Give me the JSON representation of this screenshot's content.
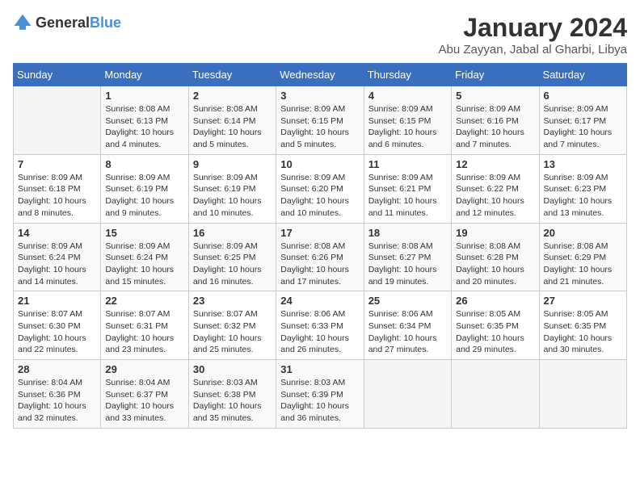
{
  "header": {
    "logo_general": "General",
    "logo_blue": "Blue",
    "month_year": "January 2024",
    "location": "Abu Zayyan, Jabal al Gharbi, Libya"
  },
  "weekdays": [
    "Sunday",
    "Monday",
    "Tuesday",
    "Wednesday",
    "Thursday",
    "Friday",
    "Saturday"
  ],
  "weeks": [
    [
      {
        "day": "",
        "info": ""
      },
      {
        "day": "1",
        "info": "Sunrise: 8:08 AM\nSunset: 6:13 PM\nDaylight: 10 hours\nand 4 minutes."
      },
      {
        "day": "2",
        "info": "Sunrise: 8:08 AM\nSunset: 6:14 PM\nDaylight: 10 hours\nand 5 minutes."
      },
      {
        "day": "3",
        "info": "Sunrise: 8:09 AM\nSunset: 6:15 PM\nDaylight: 10 hours\nand 5 minutes."
      },
      {
        "day": "4",
        "info": "Sunrise: 8:09 AM\nSunset: 6:15 PM\nDaylight: 10 hours\nand 6 minutes."
      },
      {
        "day": "5",
        "info": "Sunrise: 8:09 AM\nSunset: 6:16 PM\nDaylight: 10 hours\nand 7 minutes."
      },
      {
        "day": "6",
        "info": "Sunrise: 8:09 AM\nSunset: 6:17 PM\nDaylight: 10 hours\nand 7 minutes."
      }
    ],
    [
      {
        "day": "7",
        "info": "Sunrise: 8:09 AM\nSunset: 6:18 PM\nDaylight: 10 hours\nand 8 minutes."
      },
      {
        "day": "8",
        "info": "Sunrise: 8:09 AM\nSunset: 6:19 PM\nDaylight: 10 hours\nand 9 minutes."
      },
      {
        "day": "9",
        "info": "Sunrise: 8:09 AM\nSunset: 6:19 PM\nDaylight: 10 hours\nand 10 minutes."
      },
      {
        "day": "10",
        "info": "Sunrise: 8:09 AM\nSunset: 6:20 PM\nDaylight: 10 hours\nand 10 minutes."
      },
      {
        "day": "11",
        "info": "Sunrise: 8:09 AM\nSunset: 6:21 PM\nDaylight: 10 hours\nand 11 minutes."
      },
      {
        "day": "12",
        "info": "Sunrise: 8:09 AM\nSunset: 6:22 PM\nDaylight: 10 hours\nand 12 minutes."
      },
      {
        "day": "13",
        "info": "Sunrise: 8:09 AM\nSunset: 6:23 PM\nDaylight: 10 hours\nand 13 minutes."
      }
    ],
    [
      {
        "day": "14",
        "info": "Sunrise: 8:09 AM\nSunset: 6:24 PM\nDaylight: 10 hours\nand 14 minutes."
      },
      {
        "day": "15",
        "info": "Sunrise: 8:09 AM\nSunset: 6:24 PM\nDaylight: 10 hours\nand 15 minutes."
      },
      {
        "day": "16",
        "info": "Sunrise: 8:09 AM\nSunset: 6:25 PM\nDaylight: 10 hours\nand 16 minutes."
      },
      {
        "day": "17",
        "info": "Sunrise: 8:08 AM\nSunset: 6:26 PM\nDaylight: 10 hours\nand 17 minutes."
      },
      {
        "day": "18",
        "info": "Sunrise: 8:08 AM\nSunset: 6:27 PM\nDaylight: 10 hours\nand 19 minutes."
      },
      {
        "day": "19",
        "info": "Sunrise: 8:08 AM\nSunset: 6:28 PM\nDaylight: 10 hours\nand 20 minutes."
      },
      {
        "day": "20",
        "info": "Sunrise: 8:08 AM\nSunset: 6:29 PM\nDaylight: 10 hours\nand 21 minutes."
      }
    ],
    [
      {
        "day": "21",
        "info": "Sunrise: 8:07 AM\nSunset: 6:30 PM\nDaylight: 10 hours\nand 22 minutes."
      },
      {
        "day": "22",
        "info": "Sunrise: 8:07 AM\nSunset: 6:31 PM\nDaylight: 10 hours\nand 23 minutes."
      },
      {
        "day": "23",
        "info": "Sunrise: 8:07 AM\nSunset: 6:32 PM\nDaylight: 10 hours\nand 25 minutes."
      },
      {
        "day": "24",
        "info": "Sunrise: 8:06 AM\nSunset: 6:33 PM\nDaylight: 10 hours\nand 26 minutes."
      },
      {
        "day": "25",
        "info": "Sunrise: 8:06 AM\nSunset: 6:34 PM\nDaylight: 10 hours\nand 27 minutes."
      },
      {
        "day": "26",
        "info": "Sunrise: 8:05 AM\nSunset: 6:35 PM\nDaylight: 10 hours\nand 29 minutes."
      },
      {
        "day": "27",
        "info": "Sunrise: 8:05 AM\nSunset: 6:35 PM\nDaylight: 10 hours\nand 30 minutes."
      }
    ],
    [
      {
        "day": "28",
        "info": "Sunrise: 8:04 AM\nSunset: 6:36 PM\nDaylight: 10 hours\nand 32 minutes."
      },
      {
        "day": "29",
        "info": "Sunrise: 8:04 AM\nSunset: 6:37 PM\nDaylight: 10 hours\nand 33 minutes."
      },
      {
        "day": "30",
        "info": "Sunrise: 8:03 AM\nSunset: 6:38 PM\nDaylight: 10 hours\nand 35 minutes."
      },
      {
        "day": "31",
        "info": "Sunrise: 8:03 AM\nSunset: 6:39 PM\nDaylight: 10 hours\nand 36 minutes."
      },
      {
        "day": "",
        "info": ""
      },
      {
        "day": "",
        "info": ""
      },
      {
        "day": "",
        "info": ""
      }
    ]
  ]
}
